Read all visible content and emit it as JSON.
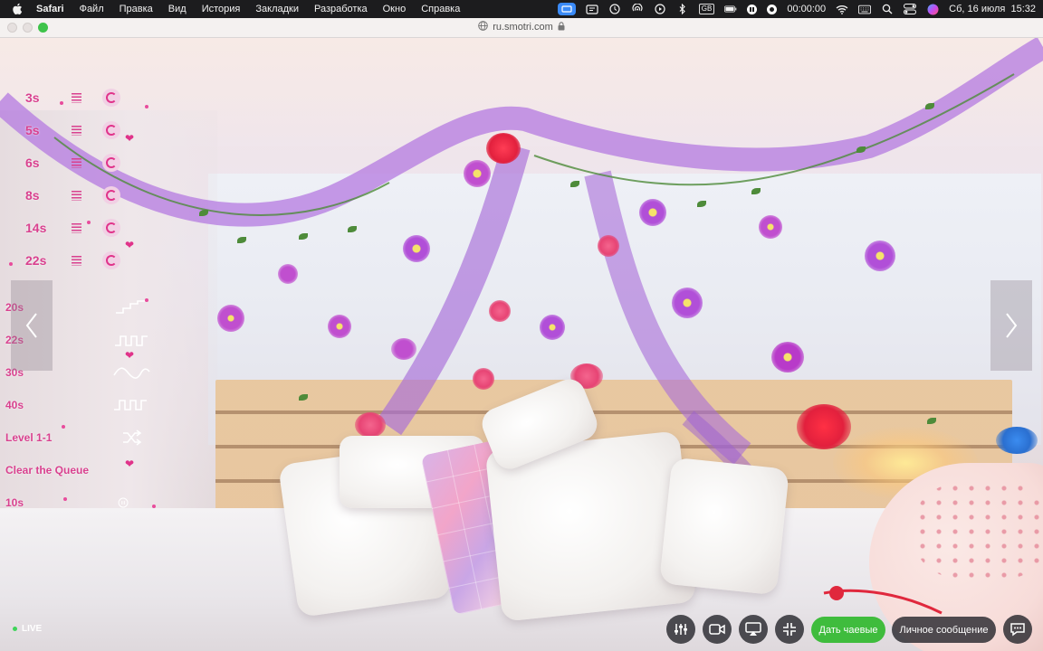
{
  "menubar": {
    "items": [
      {
        "label": "Safari",
        "bold": true
      },
      {
        "label": "Файл"
      },
      {
        "label": "Правка"
      },
      {
        "label": "Вид"
      },
      {
        "label": "История"
      },
      {
        "label": "Закладки"
      },
      {
        "label": "Разработка"
      },
      {
        "label": "Окно"
      },
      {
        "label": "Справка"
      }
    ],
    "gb_label": "GB",
    "recording_time": "00:00:00",
    "datetime": "Сб, 16 июля  15:32"
  },
  "browser": {
    "url": "ru.smotri.com"
  },
  "tip_menu": {
    "durations": [
      "3s",
      "5s",
      "6s",
      "8s",
      "14s",
      "22s"
    ],
    "patterns": [
      {
        "label": "20s",
        "icon": "stairs-up-icon"
      },
      {
        "label": "22s",
        "icon": "zigzag-wave-icon"
      },
      {
        "label": "30s",
        "icon": "sine-wave-icon"
      },
      {
        "label": "40s",
        "icon": "square-wave-icon"
      },
      {
        "label": "Level 1-1",
        "icon": "shuffle-icon"
      },
      {
        "label": "Clear the Queue",
        "icon": ""
      },
      {
        "label": "10s",
        "icon": "pause-icon"
      }
    ]
  },
  "stream": {
    "live_label": "LIVE",
    "tip_button": "Дать чаевые",
    "message_button": "Личное сообщение"
  },
  "colors": {
    "accent_pink": "#d9418f",
    "tip_green": "#3fbc3d",
    "menubar_bg": "#1c1c1e"
  }
}
